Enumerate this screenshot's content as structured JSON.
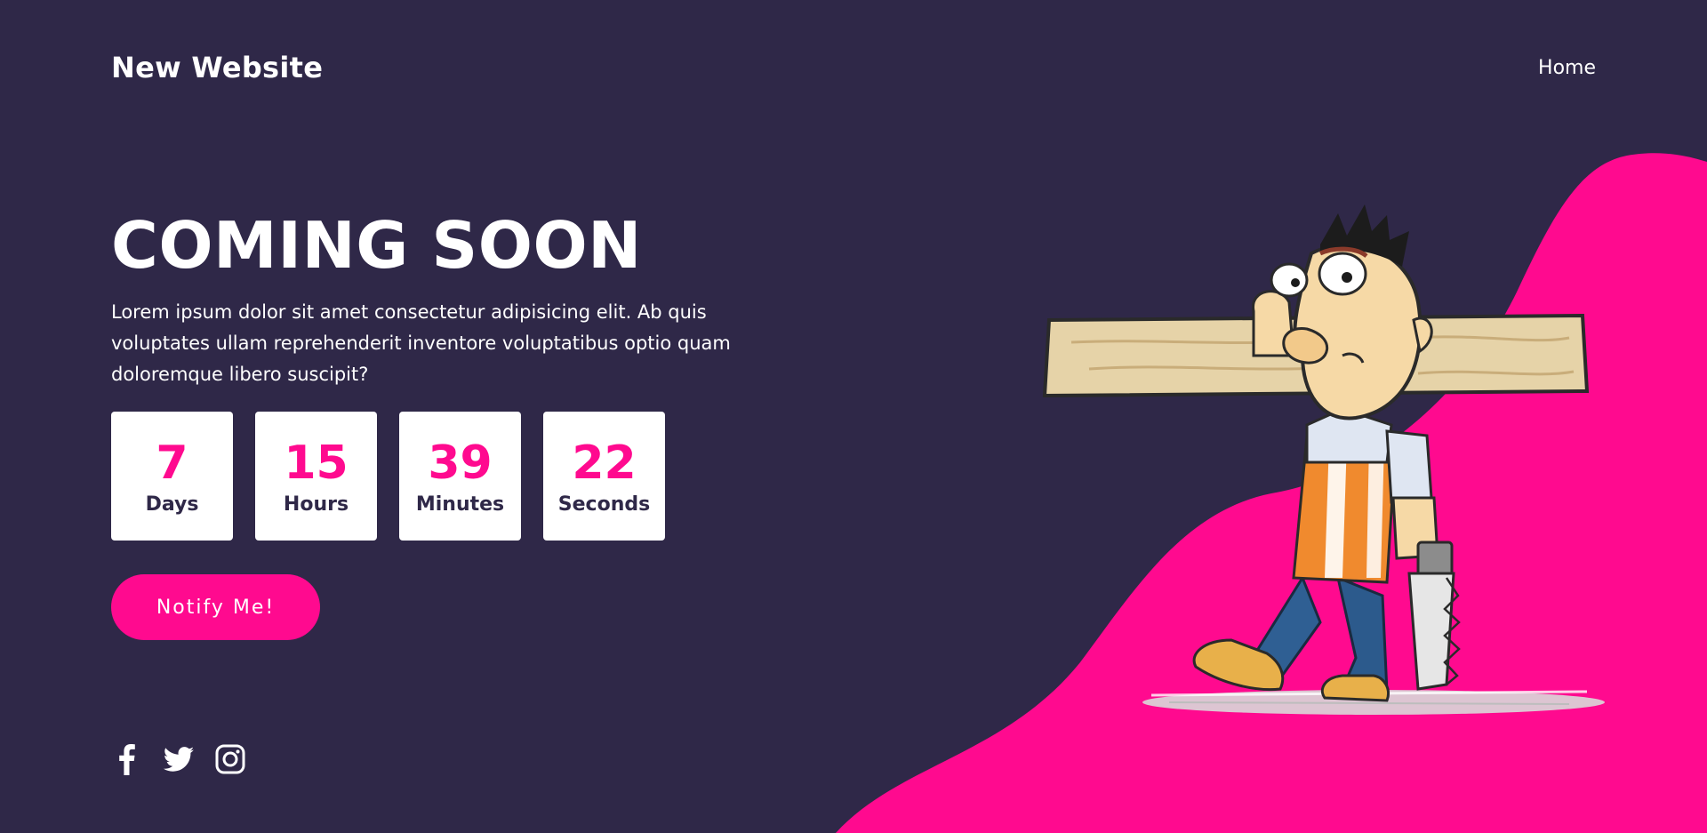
{
  "header": {
    "brand": "New Website",
    "nav": [
      {
        "label": "Home"
      }
    ]
  },
  "hero": {
    "title": "COMING SOON",
    "description": "Lorem ipsum dolor sit amet consectetur adipisicing elit. Ab quis voluptates ullam reprehenderit inventore voluptatibus optio quam doloremque libero suscipit?",
    "notify_label": "Notify Me!"
  },
  "countdown": [
    {
      "value": "7",
      "label": "Days"
    },
    {
      "value": "15",
      "label": "Hours"
    },
    {
      "value": "39",
      "label": "Minutes"
    },
    {
      "value": "22",
      "label": "Seconds"
    }
  ],
  "social": [
    {
      "icon": "facebook-icon"
    },
    {
      "icon": "twitter-icon"
    },
    {
      "icon": "instagram-icon"
    }
  ],
  "colors": {
    "background": "#2f2848",
    "accent": "#ff0a8f",
    "card": "#ffffff",
    "text": "#ffffff"
  },
  "illustration": {
    "subject": "cartoon carpenter carrying a wooden plank with a saw"
  }
}
